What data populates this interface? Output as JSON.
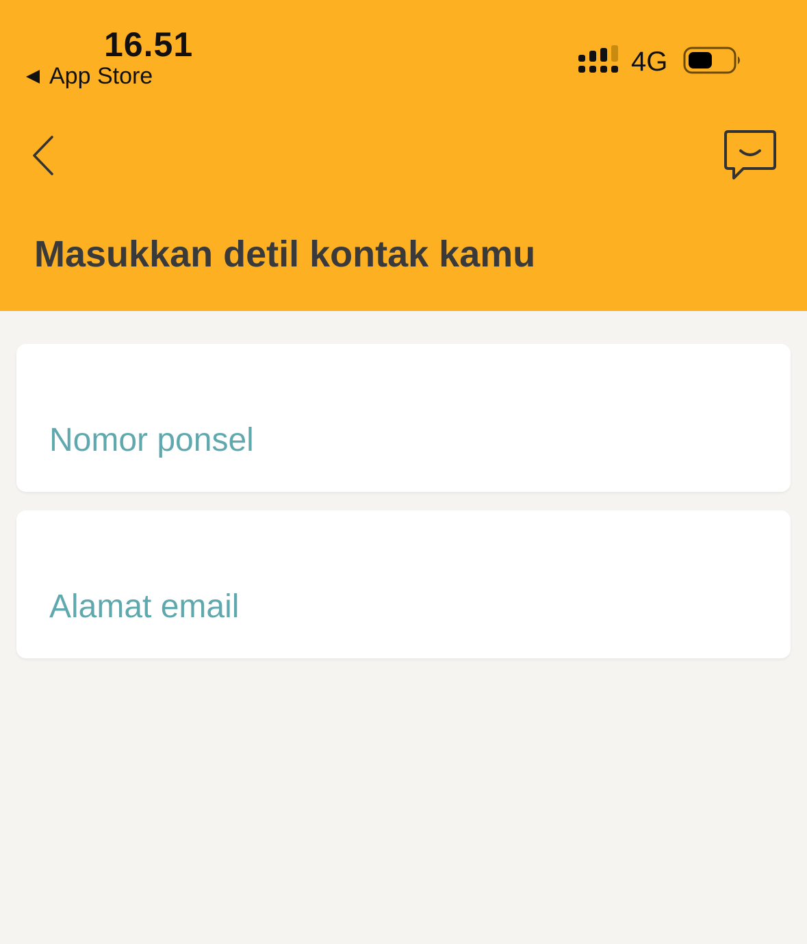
{
  "status_bar": {
    "time": "16.51",
    "back_app": "App Store",
    "network": "4G"
  },
  "nav": {
    "back_icon": "chevron-left-icon",
    "chat_icon": "chat-smile-icon"
  },
  "page": {
    "title": "Masukkan detil kontak kamu"
  },
  "form": {
    "phone_placeholder": "Nomor ponsel",
    "email_placeholder": "Alamat email"
  },
  "colors": {
    "header_bg": "#fdb022",
    "page_bg": "#f5f4f1",
    "placeholder": "#5fa8ad",
    "title": "#3a3a3a"
  }
}
